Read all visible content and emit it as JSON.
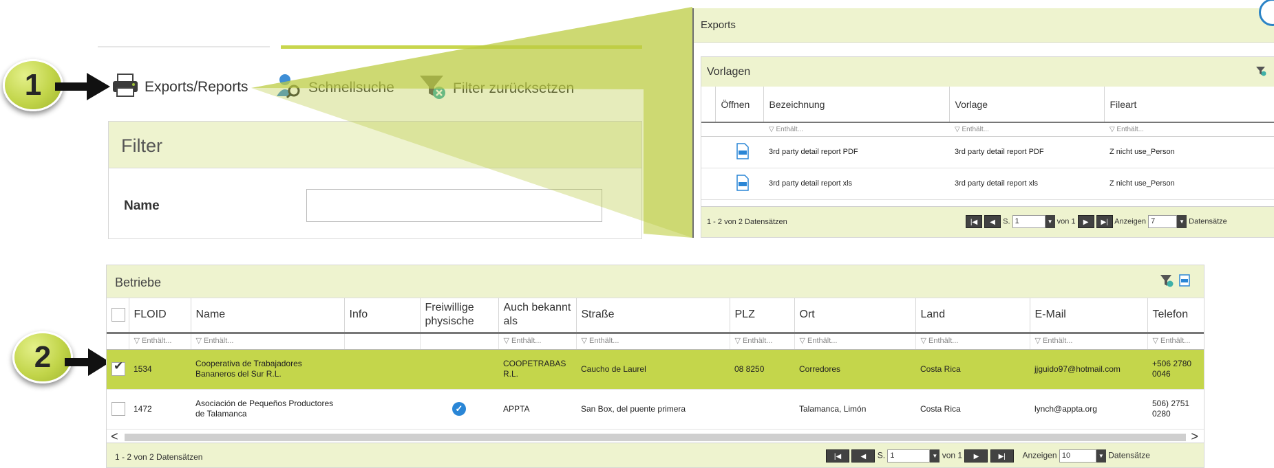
{
  "toolbar": {
    "exports_label": "Exports/Reports",
    "schnellsuche_label": "Schnellsuche",
    "filter_reset_label": "Filter zurücksetzen"
  },
  "filter": {
    "title": "Filter",
    "name_label": "Name",
    "name_value": ""
  },
  "callouts": [
    "1",
    "2"
  ],
  "exports": {
    "title": "Exports",
    "vorlagen_title": "Vorlagen",
    "columns": [
      "Öffnen",
      "Bezeichnung",
      "Vorlage",
      "Fileart"
    ],
    "filter_placeholder": "▽ Enthält...",
    "rows": [
      {
        "bezeichnung": "3rd party detail report PDF",
        "vorlage": "3rd party detail report PDF",
        "fileart": "Z nicht use_Person"
      },
      {
        "bezeichnung": "3rd party detail report xls",
        "vorlage": "3rd party detail report xls",
        "fileart": "Z nicht use_Person"
      }
    ],
    "pager": {
      "summary": "1 - 2 von 2 Datensätzen",
      "page_prefix": "S.",
      "page": "1",
      "of_text": "von 1",
      "show_label": "Anzeigen",
      "page_size": "7",
      "records_label": "Datensätze"
    }
  },
  "betriebe": {
    "title": "Betriebe",
    "columns": [
      "FLOID",
      "Name",
      "Info",
      "Freiwillige physische",
      "Auch bekannt als",
      "Straße",
      "PLZ",
      "Ort",
      "Land",
      "E-Mail",
      "Telefon"
    ],
    "filter_placeholder": "▽ Enthält...",
    "rows": [
      {
        "checked": true,
        "floid": "1534",
        "name": "Cooperativa de Trabajadores Bananeros del Sur R.L.",
        "info": "",
        "freiwillige": false,
        "auch": "COOPETRABAS R.L.",
        "strasse": "Caucho de Laurel",
        "plz": "08 8250",
        "ort": "Corredores",
        "land": "Costa Rica",
        "email": "jjguido97@hotmail.com",
        "telefon": "+506 2780 0046"
      },
      {
        "checked": false,
        "floid": "1472",
        "name": "Asociación de Pequeños Productores de Talamanca",
        "info": "",
        "freiwillige": true,
        "auch": "APPTA",
        "strasse": "San Box, del puente primera",
        "plz": "",
        "ort": "Talamanca, Limón",
        "land": "Costa Rica",
        "email": "lynch@appta.org",
        "telefon": "506) 2751 0280"
      }
    ],
    "pager": {
      "summary": "1 - 2 von 2 Datensätzen",
      "page_prefix": "S.",
      "page": "1",
      "of_text": "von 1",
      "show_label": "Anzeigen",
      "page_size": "10",
      "records_label": "Datensätze"
    }
  },
  "colors": {
    "accent_green": "#c4d64b",
    "header_tint": "#eef3cf",
    "callout_green": "#c2d54a",
    "pager_dark": "#424242",
    "verified_blue": "#2a86d6"
  }
}
